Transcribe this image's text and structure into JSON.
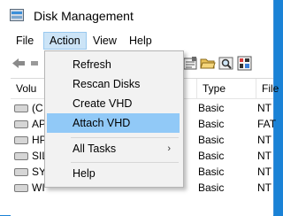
{
  "window": {
    "title": "Disk Management"
  },
  "menubar": {
    "items": [
      {
        "label": "File"
      },
      {
        "label": "Action"
      },
      {
        "label": "View"
      },
      {
        "label": "Help"
      }
    ]
  },
  "volume_list": {
    "columns": [
      {
        "label": "Volu"
      },
      {
        "label": "Type"
      },
      {
        "label": "File"
      }
    ],
    "rows": [
      {
        "name": "(C",
        "type": "Basic",
        "fs": "NT"
      },
      {
        "name": "AP",
        "type": "Basic",
        "fs": "FAT"
      },
      {
        "name": "HP",
        "type": "Basic",
        "fs": "NT"
      },
      {
        "name": "SIL",
        "type": "Basic",
        "fs": "NT"
      },
      {
        "name": "SYS",
        "type": "Basic",
        "fs": "NT"
      },
      {
        "name": "WI",
        "type": "Basic",
        "fs": "NT"
      }
    ]
  },
  "action_menu": {
    "items": [
      {
        "label": "Refresh"
      },
      {
        "label": "Rescan Disks"
      },
      {
        "label": "Create VHD"
      },
      {
        "label": "Attach VHD"
      },
      {
        "label": "All Tasks",
        "submenu_arrow": "›"
      },
      {
        "label": "Help"
      }
    ],
    "highlighted": "Attach VHD"
  },
  "colors": {
    "desktop": "#1a82d6",
    "menu_active": "#cce4f7",
    "highlight": "#91c9f7"
  }
}
